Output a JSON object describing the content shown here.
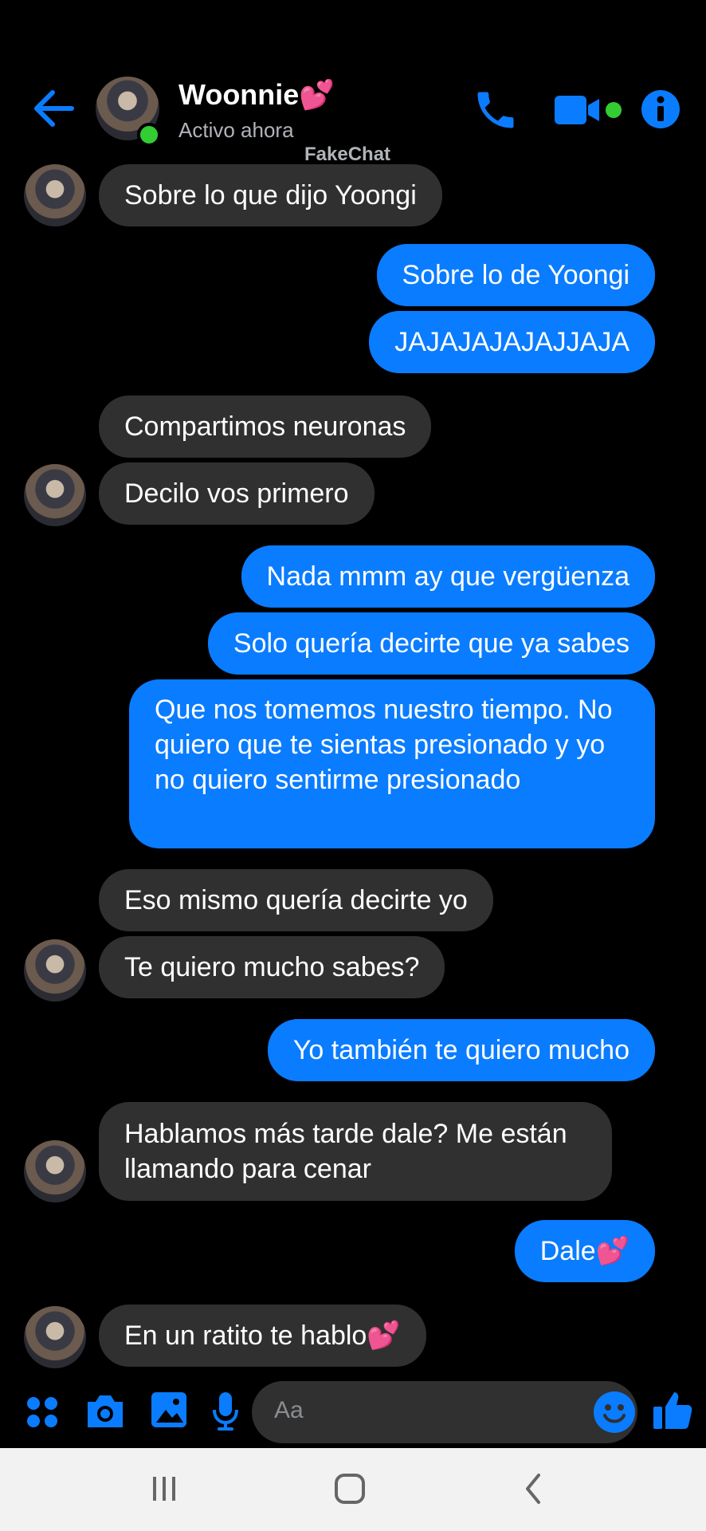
{
  "header": {
    "name": "Woonnie💕",
    "status": "Activo ahora",
    "watermark": "FakeChat"
  },
  "messages": [
    {
      "side": "in",
      "text": "Sobre lo que dijo Yoongi"
    },
    {
      "side": "out",
      "text": "Sobre lo de Yoongi"
    },
    {
      "side": "out",
      "text": "JAJAJAJAJAJJAJA"
    },
    {
      "side": "in",
      "text": "Compartimos neuronas"
    },
    {
      "side": "in",
      "text": "Decilo vos primero"
    },
    {
      "side": "out",
      "text": "Nada mmm ay que vergüenza"
    },
    {
      "side": "out",
      "text": "Solo quería decirte que ya sabes"
    },
    {
      "side": "out",
      "text": "Que nos tomemos nuestro tiempo. No quiero que te sientas presionado y yo no quiero sentirme presionado"
    },
    {
      "side": "in",
      "text": "Eso mismo quería decirte yo"
    },
    {
      "side": "in",
      "text": "Te quiero mucho sabes?"
    },
    {
      "side": "out",
      "text": "Yo también te quiero mucho"
    },
    {
      "side": "in",
      "text": "Hablamos más tarde dale? Me están llamando para cenar"
    },
    {
      "side": "out",
      "text": "Dale💕"
    },
    {
      "side": "in",
      "text": "En un ratito te hablo💕"
    }
  ],
  "composer": {
    "placeholder": "Aa"
  },
  "colors": {
    "accent": "#0a7cff",
    "incoming_bubble": "#303030",
    "online": "#33cc33"
  },
  "icons": [
    "back-arrow-icon",
    "phone-icon",
    "video-icon",
    "info-icon",
    "apps-icon",
    "camera-icon",
    "gallery-icon",
    "mic-icon",
    "emoji-icon",
    "like-icon",
    "recents-icon",
    "home-icon",
    "nav-back-icon"
  ]
}
